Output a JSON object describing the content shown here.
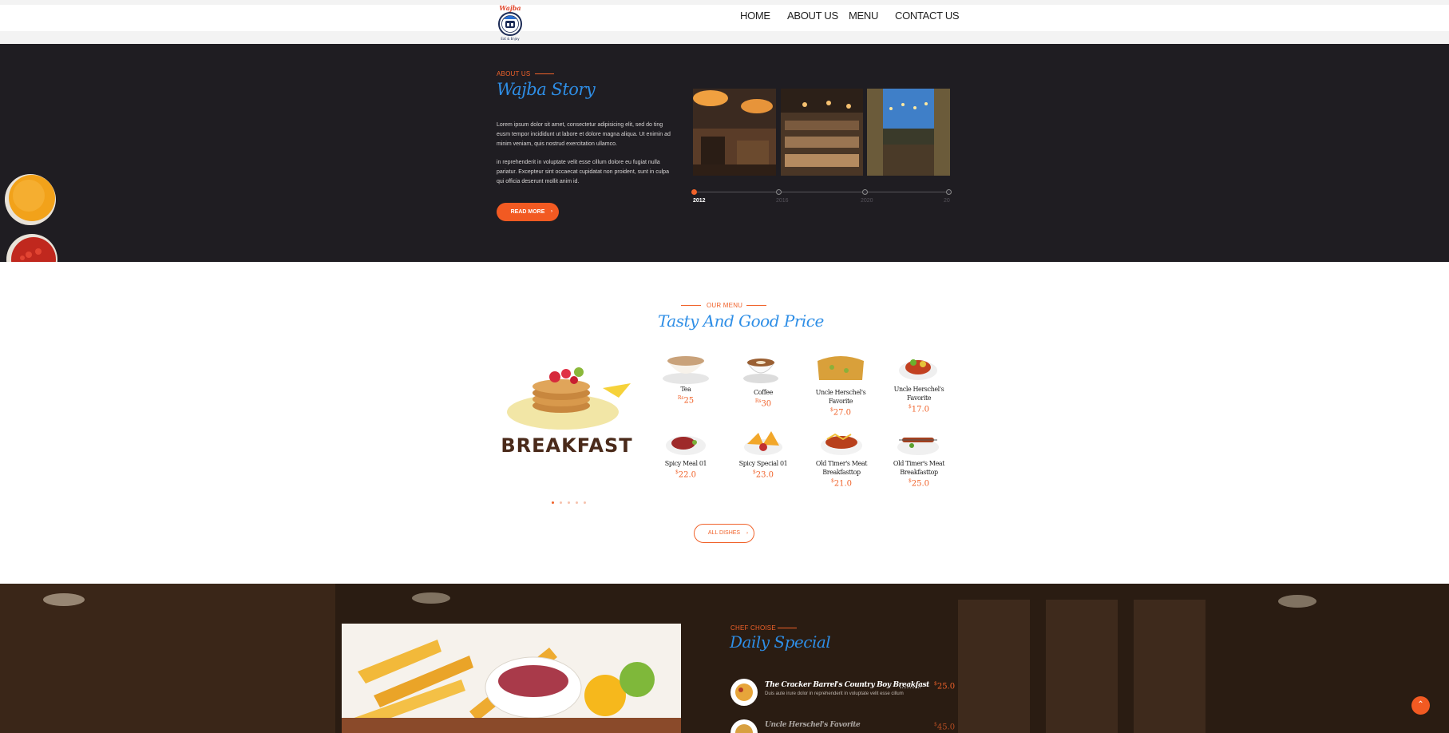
{
  "logo": {
    "name": "Wajba",
    "tagline": "Eat & Enjoy"
  },
  "nav": {
    "items": [
      "HOME",
      "ABOUT US",
      "MENU",
      "CONTACT US"
    ]
  },
  "about": {
    "eyebrow": "ABOUT US",
    "title": "Wajba Story",
    "paragraph_1": "Lorem ipsum dolor sit amet, consectetur adipisicing elit, sed do ting eusm tempor incididunt ut labore et dolore magna aliqua. Ut enimin ad minim veniam, quis nostrud exercitation ullamco.",
    "paragraph_2": "in reprehenderit in voluptate velit esse cillum dolore eu fugiat nulla pariatur. Excepteur sint occaecat cupidatat non proident, sunt in culpa qui officia deserunt mollit anim id.",
    "read_more": "READ MORE",
    "timeline": [
      "2012",
      "2016",
      "2020",
      "2024"
    ],
    "timeline_active": "2012"
  },
  "menu": {
    "eyebrow": "OUR MENU",
    "title": "Tasty And Good Price",
    "category_label": "BREAKFAST",
    "items": [
      {
        "name": "Tea",
        "currency": "Rs",
        "price": "25"
      },
      {
        "name": "Coffee",
        "currency": "Rs",
        "price": "30"
      },
      {
        "name": "Uncle Herschel's Favorite",
        "currency": "$",
        "price": "27.0"
      },
      {
        "name": "Uncle Herschel's Favorite",
        "currency": "$",
        "price": "17.0"
      },
      {
        "name": "Spicy Meal 01",
        "currency": "$",
        "price": "22.0"
      },
      {
        "name": "Spicy Special 01",
        "currency": "$",
        "price": "23.0"
      },
      {
        "name": "Old Timer's Meat Breakfasttop",
        "currency": "$",
        "price": "21.0"
      },
      {
        "name": "Old Timer's Meat Breakfasttop",
        "currency": "$",
        "price": "25.0"
      }
    ],
    "all_dishes": "ALL DISHES"
  },
  "daily": {
    "eyebrow": "CHEF CHOISE",
    "title": "Daily Special",
    "dishes": [
      {
        "name": "The Cracker Barrel's Country Boy Breakfast",
        "desc": "Duis aute irure dolor in reprehenderit in voluptate velit esse cillum",
        "currency": "$",
        "price": "25.0"
      },
      {
        "name": "Uncle Herschel's Favorite",
        "desc": "",
        "currency": "$",
        "price": "45.0"
      }
    ]
  },
  "colors": {
    "accent": "#f25a22",
    "title_blue": "#2e8ee6",
    "dark_bg": "#1f1d22"
  },
  "icons": {
    "to_top": "chevron-up-icon",
    "button_arrow": "arrow-right-icon"
  }
}
